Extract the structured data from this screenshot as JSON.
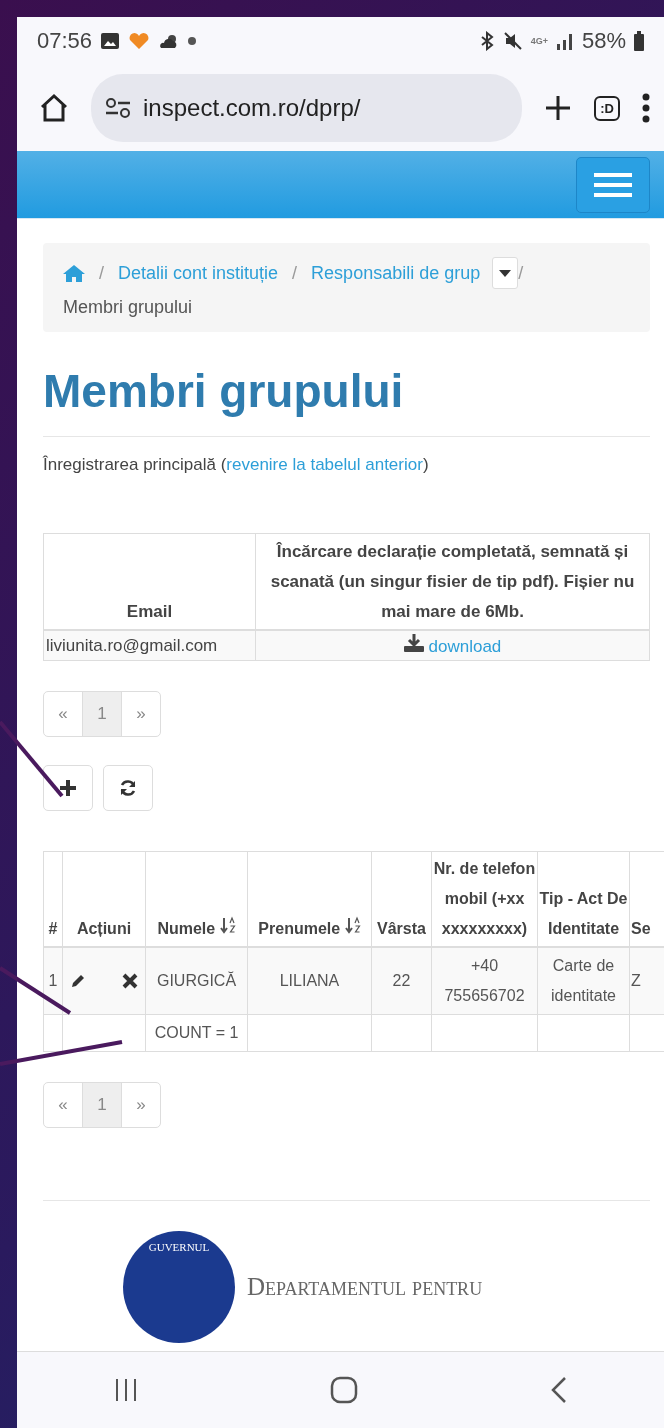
{
  "status_bar": {
    "time": "07:56",
    "network": "4G+",
    "battery": "58%"
  },
  "browser": {
    "url": "inspect.com.ro/dprp/",
    "tabs_button": ":D"
  },
  "breadcrumb": {
    "separator": "/",
    "items": [
      {
        "label": "Detalii cont instituție",
        "kind": "link"
      },
      {
        "label": "Responsabili de grup",
        "kind": "dropdown"
      },
      {
        "label": "Membri grupului",
        "kind": "current"
      }
    ]
  },
  "page_title": "Membri grupului",
  "intro": {
    "text": "Înregistrarea principală (",
    "link": "revenire la tabelul anterior",
    "after": ")"
  },
  "main_record": {
    "columns": [
      "Email",
      "Încărcare declarație completată, semnată și scanată (un singur fisier de tip pdf). Fișier nu mai mare de 6Mb."
    ],
    "rows": [
      {
        "email": "liviunita.ro@gmail.com",
        "file": "download"
      }
    ]
  },
  "pagination_top": [
    {
      "label": "«",
      "selected": false
    },
    {
      "label": "1",
      "selected": true
    },
    {
      "label": "»",
      "selected": false
    }
  ],
  "members": {
    "columns": [
      {
        "label": "#",
        "sortable": false
      },
      {
        "label": "Acțiuni",
        "sortable": false
      },
      {
        "label": "Numele",
        "sortable": true
      },
      {
        "label": "Prenumele",
        "sortable": true
      },
      {
        "label": "Vârsta",
        "sortable": false
      },
      {
        "label": "Nr. de telefon mobil (+xx xxxxxxxxx)",
        "sortable": false
      },
      {
        "label": "Tip - Act De Identitate",
        "sortable": false
      },
      {
        "label": "Se",
        "sortable": false
      }
    ],
    "rows": [
      {
        "cells": [
          "1",
          "",
          "GIURGICĂ",
          "LILIANA",
          "22",
          "+40 755656702",
          "Carte de identitate",
          "Z"
        ]
      }
    ],
    "footer": {
      "label": "COUNT = 1"
    }
  },
  "pagination_bottom": [
    {
      "label": "«",
      "selected": false
    },
    {
      "label": "1",
      "selected": true
    },
    {
      "label": "»",
      "selected": false
    }
  ],
  "footer": {
    "emblem_text": "GUVERNUL",
    "department": "Departamentul pentru"
  }
}
